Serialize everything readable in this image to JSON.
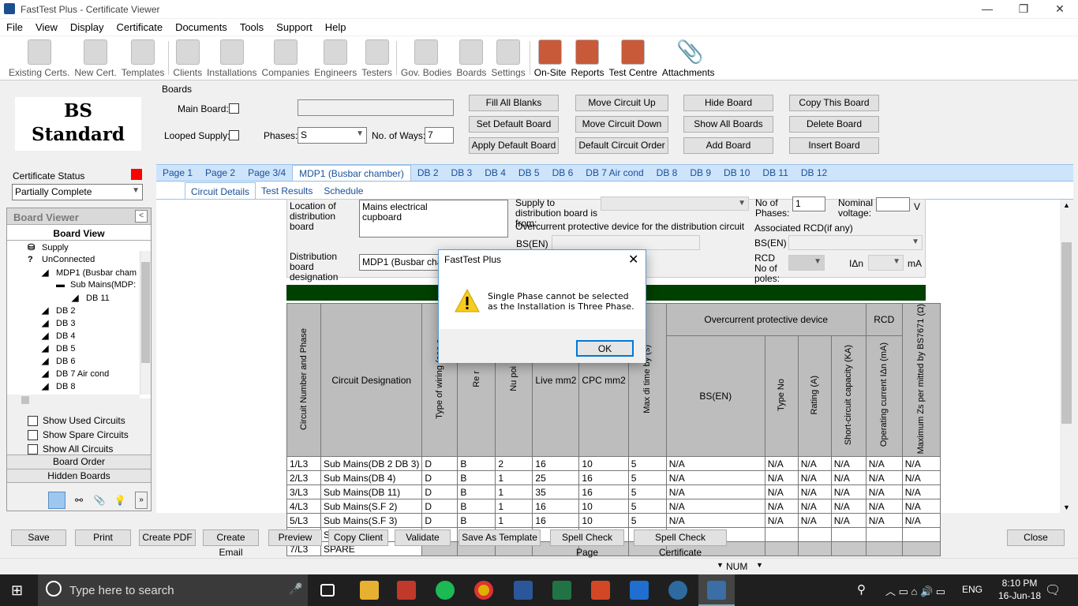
{
  "window": {
    "title": "FastTest Plus - Certificate Viewer"
  },
  "menu": [
    "File",
    "View",
    "Display",
    "Certificate",
    "Documents",
    "Tools",
    "Support",
    "Help"
  ],
  "toolbar": [
    "Existing Certs.",
    "New Cert.",
    "Templates",
    "Clients",
    "Installations",
    "Companies",
    "Engineers",
    "Testers",
    "Gov. Bodies",
    "Boards",
    "Settings",
    "On-Site",
    "Reports",
    "Test Centre",
    "Attachments"
  ],
  "logo": {
    "line1": "BS",
    "line2": "Standard"
  },
  "cert_status": {
    "label": "Certificate Status",
    "value": "Partially Complete",
    "color": "#ff0000"
  },
  "board_viewer": {
    "title": "Board Viewer",
    "view_label": "Board View",
    "tree": [
      "Supply",
      "UnConnected",
      "MDP1 (Busbar cham",
      "Sub Mains(MDP:",
      "DB 11",
      "DB 2",
      "DB 3",
      "DB 4",
      "DB 5",
      "DB 6",
      "DB 7 Air cond",
      "DB 8"
    ],
    "options": [
      "Show Used Circuits",
      "Show Spare Circuits",
      "Show All Circuits"
    ],
    "board_order": "Board Order",
    "hidden_boards": "Hidden Boards"
  },
  "boards": {
    "title": "Boards",
    "main_board": "Main Board:",
    "looped_supply": "Looped Supply:",
    "phases_label": "Phases:",
    "phases_value": "S",
    "ways_label": "No. of Ways:",
    "ways_value": "7",
    "buttons": [
      "Fill All Blanks",
      "Set Default Board",
      "Apply Default Board",
      "Move Circuit Up",
      "Move Circuit Down",
      "Default Circuit Order",
      "Hide Board",
      "Show All Boards",
      "Add Board",
      "Copy This Board",
      "Delete Board",
      "Insert Board"
    ]
  },
  "tabs": [
    "Page 1",
    "Page 2",
    "Page 3/4",
    "MDP1 (Busbar chamber)",
    "DB 2",
    "DB 3",
    "DB 4",
    "DB 5",
    "DB 6",
    "DB 7 Air cond",
    "DB 8",
    "DB 9",
    "DB 10",
    "DB 11",
    "DB 12"
  ],
  "subtabs": [
    "Circuit Details",
    "Test Results",
    "Schedule"
  ],
  "form": {
    "location_label": "Location of distribution board",
    "location_value": "Mains electrical\ncupboard",
    "designation_label": "Distribution board designation",
    "designation_value": "MDP1 (Busbar cham",
    "supply_label": "Supply to distribution board is from:",
    "ocpd_label": "Overcurrent protective device for the distribution circuit",
    "bsen": "BS(EN)",
    "phases_label": "No of Phases:",
    "phases_value": "1",
    "nominal_label": "Nominal voltage:",
    "v": "V",
    "rcd_label": "Associated RCD(if any)",
    "rcd_bsen": "BS(EN)",
    "rcd_poles": "RCD No of poles:",
    "idn": "IΔn",
    "ma": "mA"
  },
  "table": {
    "group_headers": {
      "ocpd": "Overcurrent protective device",
      "rcd": "RCD"
    },
    "headers": [
      "Circuit Number and Phase",
      "Circuit Designation",
      "Type of wiring (see c",
      "Re r",
      "Nu poi",
      "Live mm2",
      "CPC mm2",
      "Max di time by (s)",
      "BS(EN)",
      "Type No",
      "Rating (A)",
      "Short-circuit capacity (KA)",
      "Operating current IΔn (mA)",
      "Maximum Zs per mitted by BS7671 (Ω)"
    ],
    "rows": [
      [
        "1/L3",
        "Sub Mains(DB 2 DB 3)",
        "D",
        "B",
        "2",
        "16",
        "10",
        "5",
        "N/A",
        "N/A",
        "N/A",
        "N/A",
        "N/A",
        "N/A"
      ],
      [
        "2/L3",
        "Sub Mains(DB 4)",
        "D",
        "B",
        "1",
        "25",
        "16",
        "5",
        "N/A",
        "N/A",
        "N/A",
        "N/A",
        "N/A",
        "N/A"
      ],
      [
        "3/L3",
        "Sub Mains(DB 11)",
        "D",
        "B",
        "1",
        "35",
        "16",
        "5",
        "N/A",
        "N/A",
        "N/A",
        "N/A",
        "N/A",
        "N/A"
      ],
      [
        "4/L3",
        "Sub Mains(S.F 2)",
        "D",
        "B",
        "1",
        "16",
        "10",
        "5",
        "N/A",
        "N/A",
        "N/A",
        "N/A",
        "N/A",
        "N/A"
      ],
      [
        "5/L3",
        "Sub Mains(S.F 3)",
        "D",
        "B",
        "1",
        "16",
        "10",
        "5",
        "N/A",
        "N/A",
        "N/A",
        "N/A",
        "N/A",
        "N/A"
      ],
      [
        "6/L3",
        "Sub Mains()",
        "",
        "",
        "",
        "",
        "",
        "",
        "",
        "",
        "",
        "",
        "",
        ""
      ],
      [
        "7/L3",
        "SPARE",
        "",
        "",
        "",
        "",
        "",
        "",
        "",
        "",
        "",
        "",
        "",
        ""
      ]
    ]
  },
  "dialog": {
    "title": "FastTest Plus",
    "message1": "Single Phase cannot be selected",
    "message2": "as the Installation is Three Phase.",
    "ok": "OK"
  },
  "bottom_buttons": [
    "Save",
    "Print",
    "Create PDF",
    "Create Email",
    "Preview",
    "Copy Client",
    "Validate",
    "Save As Template",
    "Spell Check Page",
    "Spell Check Certificate"
  ],
  "close": "Close",
  "status": {
    "num": "NUM"
  },
  "taskbar": {
    "search": "Type here to search",
    "lang": "ENG",
    "time": "8:10 PM",
    "date": "16-Jun-18"
  }
}
